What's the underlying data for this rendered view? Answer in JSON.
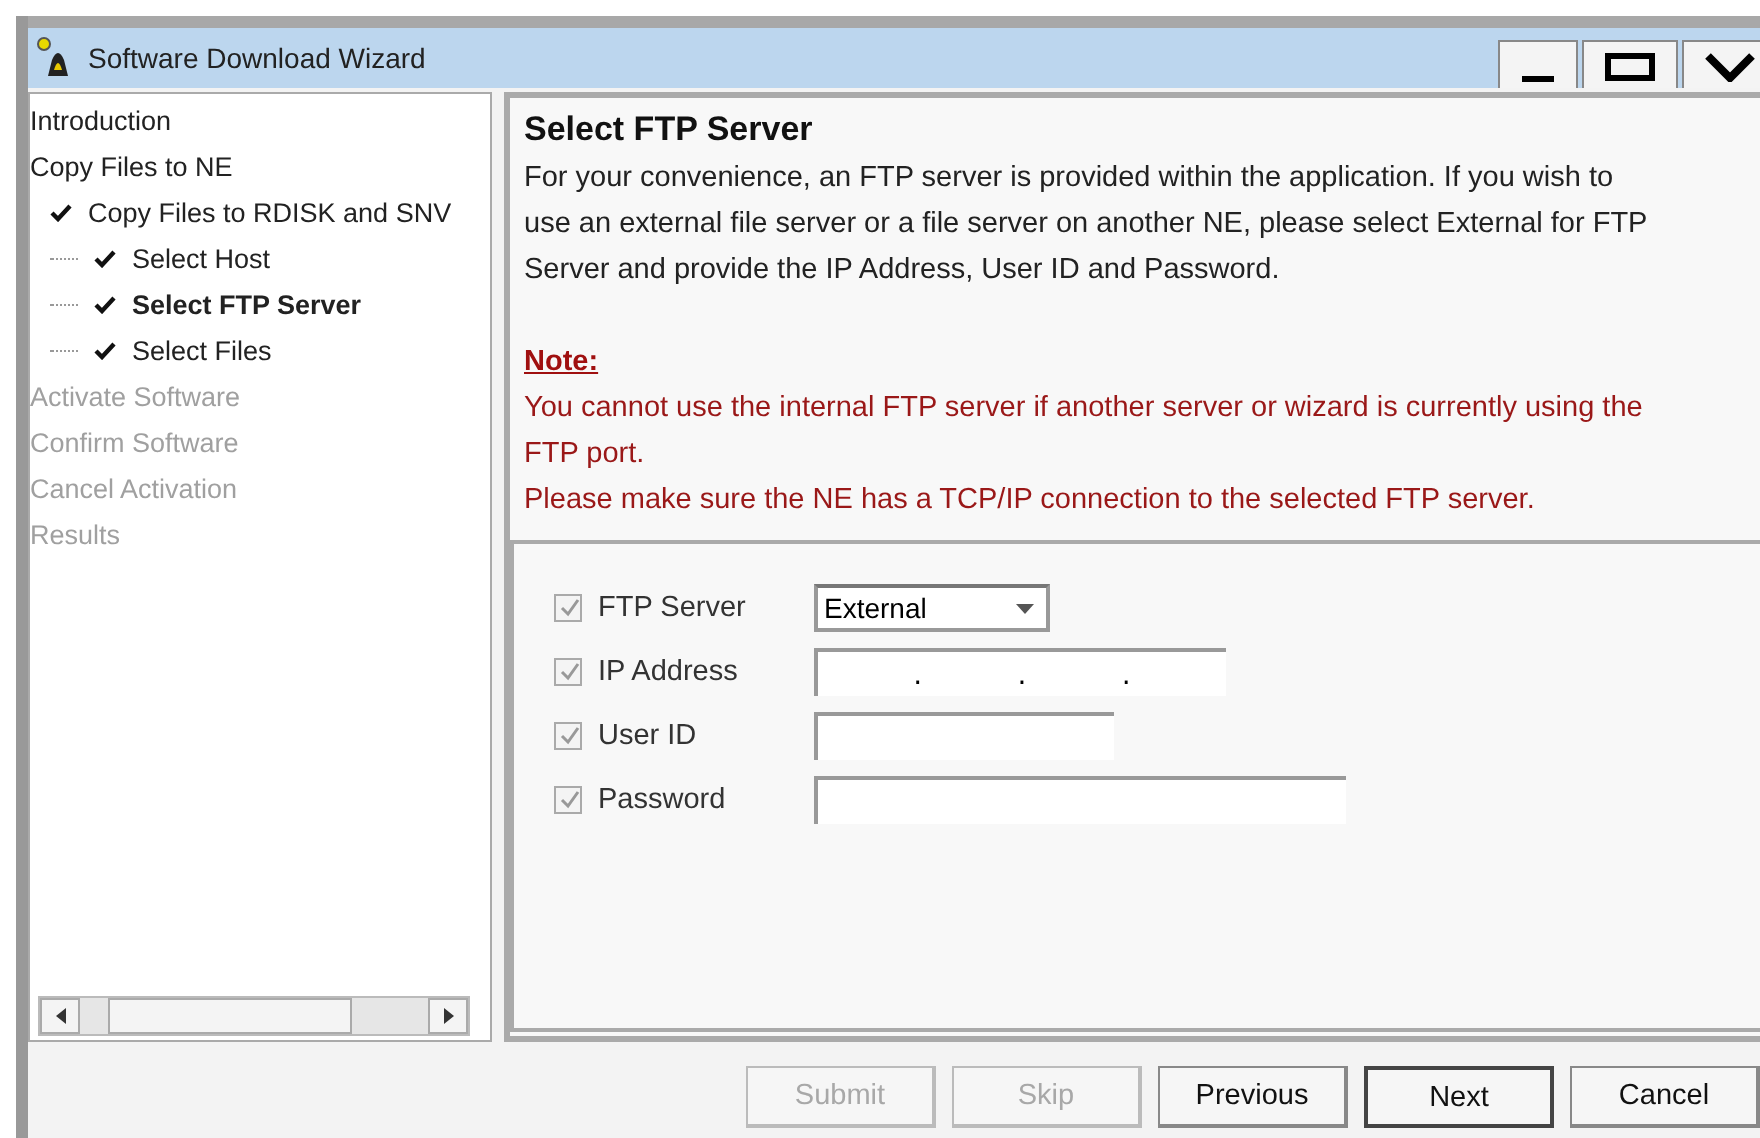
{
  "window": {
    "title": "Software Download Wizard"
  },
  "steps": [
    {
      "label": "Introduction",
      "enabled": true,
      "checked": false,
      "selected": false
    },
    {
      "label": "Copy Files to NE",
      "enabled": true,
      "checked": false,
      "selected": false,
      "children": [
        {
          "label": "Copy Files to RDISK and SNV",
          "enabled": true,
          "checked": true,
          "selected": false,
          "children": [
            {
              "label": "Select Host",
              "enabled": true,
              "checked": true,
              "selected": false
            },
            {
              "label": "Select FTP Server",
              "enabled": true,
              "checked": true,
              "selected": true
            },
            {
              "label": "Select Files",
              "enabled": true,
              "checked": true,
              "selected": false
            }
          ]
        }
      ]
    },
    {
      "label": "Activate Software",
      "enabled": false,
      "checked": false,
      "selected": false
    },
    {
      "label": "Confirm Software",
      "enabled": false,
      "checked": false,
      "selected": false
    },
    {
      "label": "Cancel Activation",
      "enabled": false,
      "checked": false,
      "selected": false
    },
    {
      "label": "Results",
      "enabled": false,
      "checked": false,
      "selected": false
    }
  ],
  "page": {
    "heading": "Select FTP Server",
    "intro": "For your convenience, an FTP server is provided within the application. If you wish to use an external file server or a file server on another NE, please select External for FTP Server and provide the IP Address, User ID and Password.",
    "note_label": "Note:",
    "notes": [
      "You cannot use the internal FTP server if another server or wizard is currently using the FTP port.",
      "Please make sure the NE has a TCP/IP connection to the selected FTP server."
    ]
  },
  "fields": [
    {
      "kind": "dropdown",
      "label": "FTP Server",
      "checked": true,
      "value": "External"
    },
    {
      "kind": "ip",
      "label": "IP Address",
      "checked": true,
      "separators": [
        ".",
        ".",
        "."
      ]
    },
    {
      "kind": "text",
      "label": "User ID",
      "checked": true
    },
    {
      "kind": "wide",
      "label": "Password",
      "checked": true
    }
  ],
  "buttons": [
    {
      "label": "Submit",
      "disabled": true
    },
    {
      "label": "Skip",
      "disabled": true
    },
    {
      "label": "Previous",
      "disabled": false
    },
    {
      "label": "Next",
      "disabled": false
    },
    {
      "label": "Cancel",
      "disabled": false
    }
  ]
}
